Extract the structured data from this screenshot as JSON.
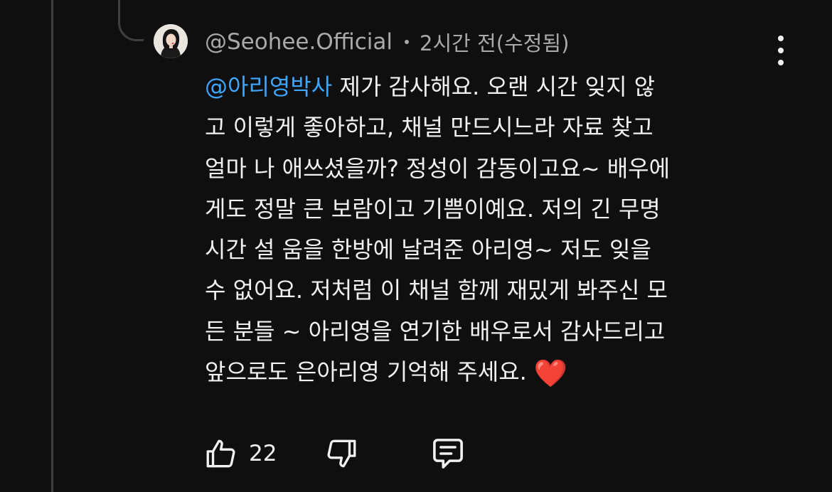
{
  "comment": {
    "author": "@Seohee.Official",
    "timestamp": "2시간 전(수정됨)",
    "mention": "@아리영박사",
    "text_lines": [
      " 제가 감사해요. 오랜 시간 잊지 않",
      "고 이렇게 좋아하고, 채널 만드시느라 자료 찾고",
      "얼마 나 애쓰셨을까? 정성이 감동이고요~ 배우에",
      "게도 정말 큰 보람이고 기쁨이예요. 저의 긴 무명",
      "시간 설 움을 한방에 날려준 아리영~ 저도 잊을",
      "수 없어요. 저처럼 이 채널 함께 재밌게 봐주신 모",
      "든 분들 ~ 아리영을 연기한 배우로서 감사드리고",
      "앞으로도 은아리영 기억해 주세요."
    ],
    "emoji": "❤️",
    "like_count": "22"
  },
  "icons": {
    "more": "more-vertical-icon",
    "like": "thumbs-up-icon",
    "dislike": "thumbs-down-icon",
    "reply": "comment-reply-icon"
  },
  "colors": {
    "background": "#0f0f0f",
    "text": "#f1f1f1",
    "secondary_text": "#aaaaaa",
    "mention": "#3ea6ff",
    "thread_line": "#3f3f3f"
  }
}
